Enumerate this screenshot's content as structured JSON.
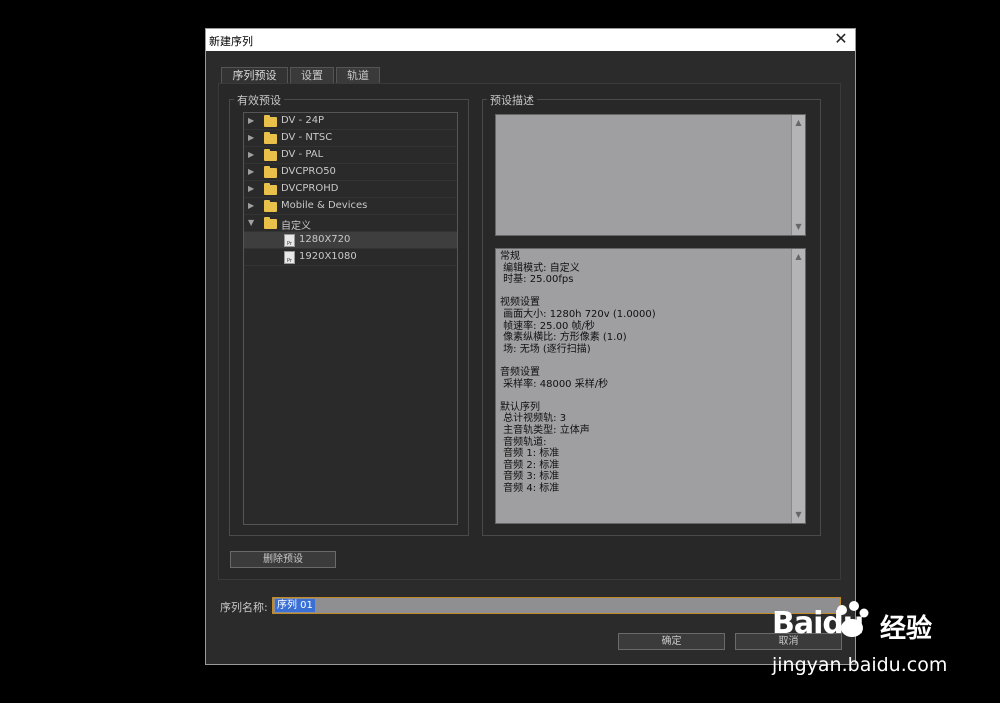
{
  "dialog": {
    "title": "新建序列",
    "close_glyph": "✕"
  },
  "tabs": [
    {
      "label": "序列预设",
      "active": true
    },
    {
      "label": "设置",
      "active": false
    },
    {
      "label": "轨道",
      "active": false
    }
  ],
  "presets": {
    "group_label": "有效预设",
    "items": [
      {
        "label": "DV - 24P",
        "type": "folder",
        "expanded": false
      },
      {
        "label": "DV - NTSC",
        "type": "folder",
        "expanded": false
      },
      {
        "label": "DV - PAL",
        "type": "folder",
        "expanded": false
      },
      {
        "label": "DVCPRO50",
        "type": "folder",
        "expanded": false
      },
      {
        "label": "DVCPROHD",
        "type": "folder",
        "expanded": false
      },
      {
        "label": "Mobile & Devices",
        "type": "folder",
        "expanded": false
      },
      {
        "label": "自定义",
        "type": "folder",
        "expanded": true
      },
      {
        "label": "1280X720",
        "type": "file",
        "selected": true
      },
      {
        "label": "1920X1080",
        "type": "file",
        "selected": false
      }
    ],
    "file_icon_text": "Pr"
  },
  "description": {
    "group_label": "预设描述",
    "top_text": "",
    "details": "常规\n 编辑模式: 自定义\n 时基: 25.00fps\n\n视频设置\n 画面大小: 1280h 720v (1.0000)\n 帧速率: 25.00 帧/秒\n 像素纵横比: 方形像素 (1.0)\n 场: 无场 (逐行扫描)\n\n音频设置\n 采样率: 48000 采样/秒\n\n默认序列\n 总计视频轨: 3\n 主音轨类型: 立体声\n 音频轨道:\n 音频 1: 标准\n 音频 2: 标准\n 音频 3: 标准\n 音频 4: 标准"
  },
  "buttons": {
    "delete_preset": "删除预设",
    "ok": "确定",
    "cancel": "取消"
  },
  "sequence_name": {
    "label": "序列名称:",
    "value": "序列 01"
  },
  "watermark": {
    "brand": "Bai",
    "brand_suffix": "du",
    "product": "经验",
    "url": "jingyan.baidu.com"
  },
  "colors": {
    "dialog_bg": "#2b2b2b",
    "selection": "#3a6fd6",
    "folder": "#e8c04a",
    "input_focus": "#c08a2a"
  }
}
